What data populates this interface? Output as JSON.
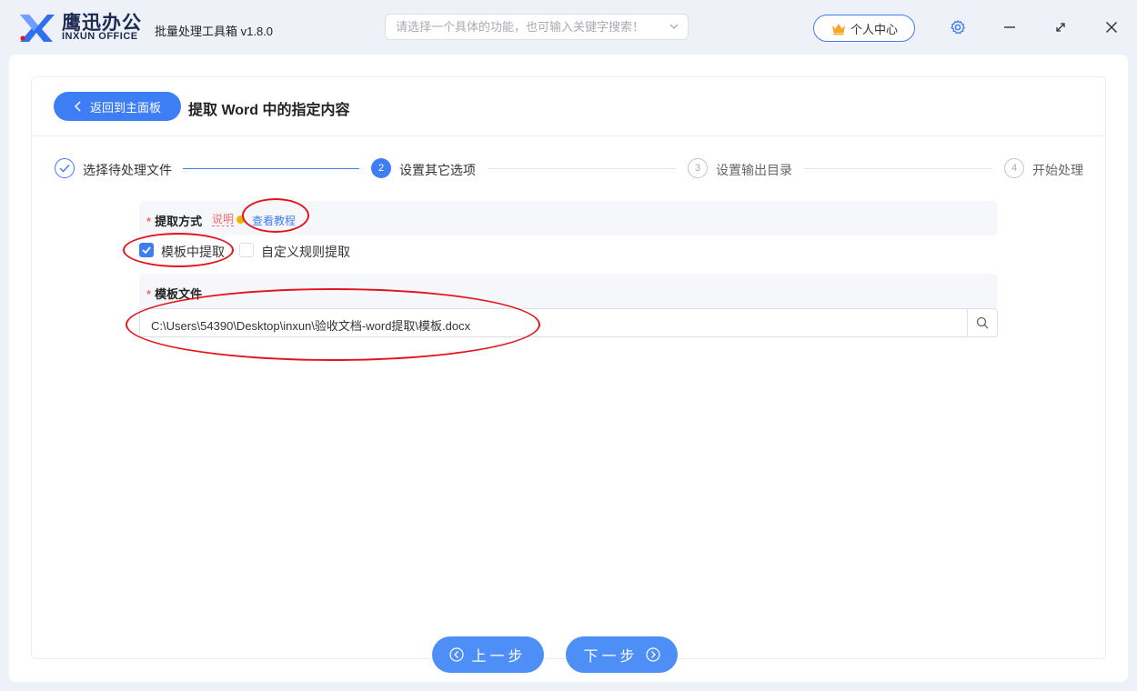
{
  "app": {
    "brand_cn": "鹰迅办公",
    "brand_en": "INXUN OFFICE",
    "title": "批量处理工具箱 v1.8.0"
  },
  "search": {
    "placeholder": "请选择一个具体的功能，也可输入关键字搜索！",
    "value": ""
  },
  "header": {
    "user_center_label": "个人中心",
    "icons": [
      "crown-icon",
      "settings-gear-icon",
      "minimize-icon",
      "maximize-icon",
      "close-icon"
    ]
  },
  "page": {
    "back_label": "返回到主面板",
    "title": "提取 Word 中的指定内容"
  },
  "steps": [
    {
      "number": "1",
      "label": "选择待处理文件",
      "status": "done"
    },
    {
      "number": "2",
      "label": "设置其它选项",
      "status": "active"
    },
    {
      "number": "3",
      "label": "设置输出目录",
      "status": "pending"
    },
    {
      "number": "4",
      "label": "开始处理",
      "status": "pending"
    }
  ],
  "extract_mode": {
    "required_mark": "*",
    "title": "提取方式",
    "note_label": "说明",
    "tutorial_label": "查看教程",
    "options": [
      {
        "label": "模板中提取",
        "checked": true
      },
      {
        "label": "自定义规则提取",
        "checked": false
      }
    ]
  },
  "template_file": {
    "required_mark": "*",
    "title": "模板文件",
    "path": "C:\\Users\\54390\\Desktop\\inxun\\验收文档-word提取\\模板.docx"
  },
  "footer": {
    "prev_label": "上一步",
    "next_label": "下一步"
  },
  "colors": {
    "primary": "#3d7ef5",
    "annotation": "#e4141c",
    "required": "#f56c6c",
    "background": "#eef1f7"
  }
}
